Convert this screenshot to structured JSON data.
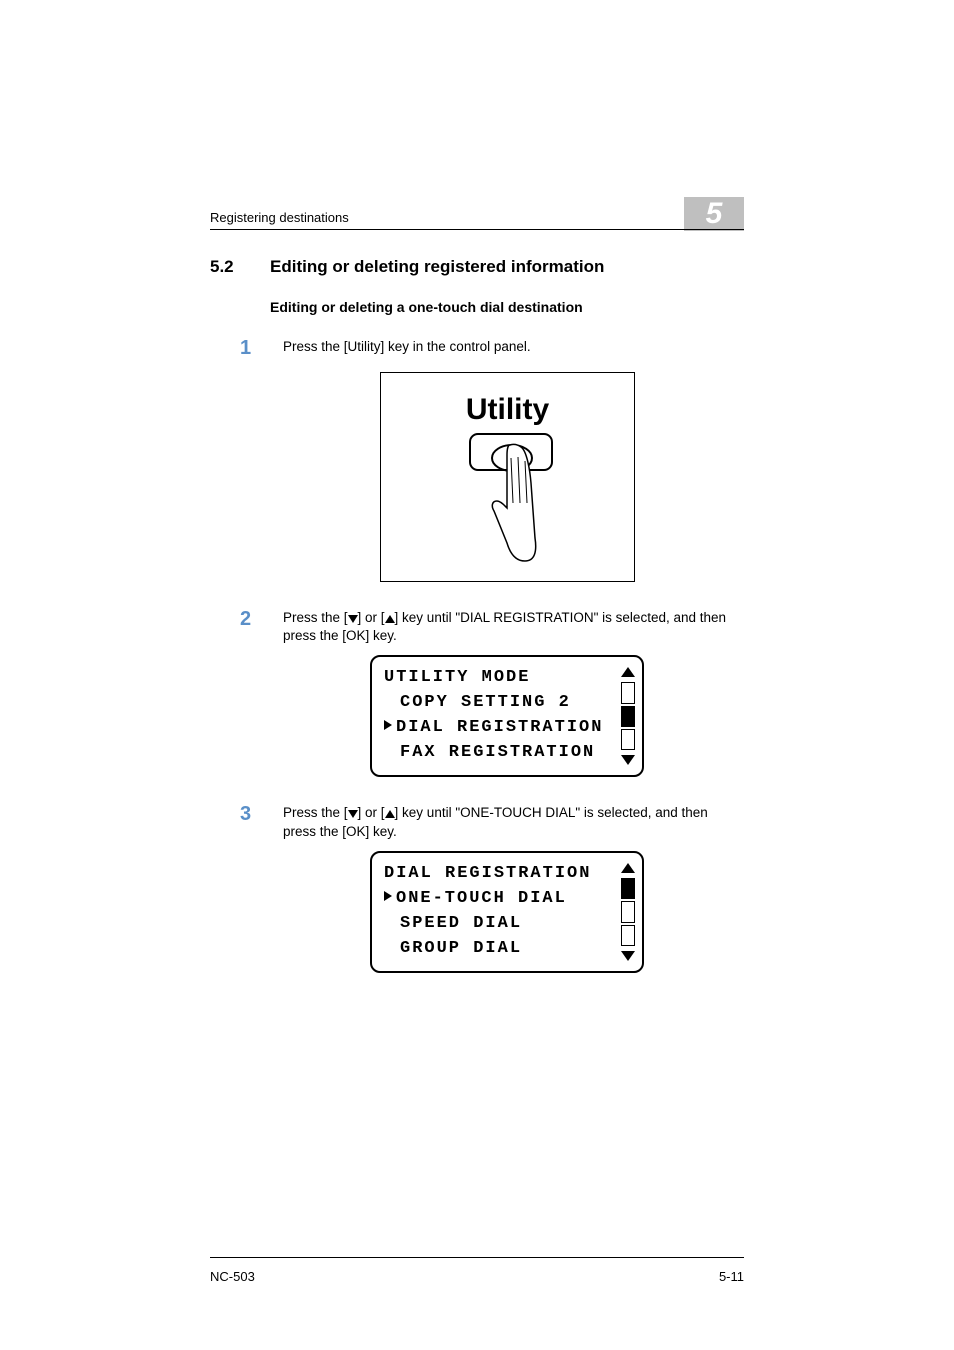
{
  "header": {
    "running_head": "Registering destinations",
    "chapter_number": "5"
  },
  "section": {
    "number": "5.2",
    "title": "Editing or deleting registered information"
  },
  "subheading": "Editing or deleting a one-touch dial destination",
  "steps": {
    "s1": {
      "num": "1",
      "text": "Press the [Utility] key in the control panel."
    },
    "s2": {
      "num": "2",
      "text_a": "Press the [",
      "text_b": "] or [",
      "text_c": "] key until \"DIAL REGISTRATION\" is selected, and then press the [OK] key."
    },
    "s3": {
      "num": "3",
      "text_a": "Press the [",
      "text_b": "] or [",
      "text_c": "] key until \"ONE-TOUCH DIAL\" is selected, and then press the [OK] key."
    }
  },
  "utility_label": "Utility",
  "lcd1": {
    "l1": "UTILITY MODE",
    "l2": "COPY SETTING 2",
    "l3": "DIAL REGISTRATION",
    "l4": "FAX REGISTRATION"
  },
  "lcd2": {
    "l1": "DIAL REGISTRATION",
    "l2": "ONE-TOUCH DIAL",
    "l3": "SPEED DIAL",
    "l4": "GROUP DIAL"
  },
  "footer": {
    "left": "NC-503",
    "right": "5-11"
  }
}
